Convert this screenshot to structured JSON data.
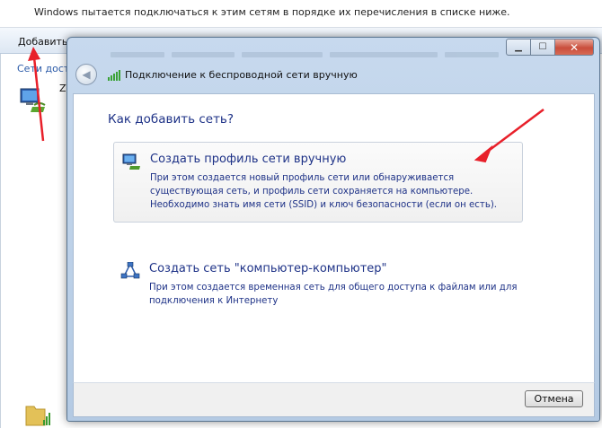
{
  "background": {
    "instruction": "Windows пытается подключаться к этим сетям в порядке их перечисления в списке ниже.",
    "add_label": "Добавить",
    "networks_label": "Сети досту",
    "network_name": "ZV"
  },
  "dialog": {
    "title_icon": "wireless-signal-icon",
    "header_title": "Подключение к беспроводной сети вручную",
    "question": "Как добавить сеть?",
    "options": [
      {
        "title": "Создать профиль сети вручную",
        "description": "При этом создается новый профиль сети или обнаруживается существующая сеть, и профиль сети сохраняется на компьютере. Необходимо знать имя сети (SSID) и ключ безопасности (если он есть).",
        "icon": "network-computer-icon"
      },
      {
        "title": "Создать сеть \"компьютер-компьютер\"",
        "description": "При этом создается временная сеть для общего доступа к файлам или для подключения к Интернету",
        "icon": "adhoc-network-icon"
      }
    ],
    "cancel_label": "Отмена",
    "window_buttons": {
      "minimize": "minimize-icon",
      "maximize": "maximize-icon",
      "close": "close-icon"
    }
  },
  "colors": {
    "link_text": "#1e3287",
    "arrow": "#e8202a",
    "frame": "#b4cae3"
  }
}
